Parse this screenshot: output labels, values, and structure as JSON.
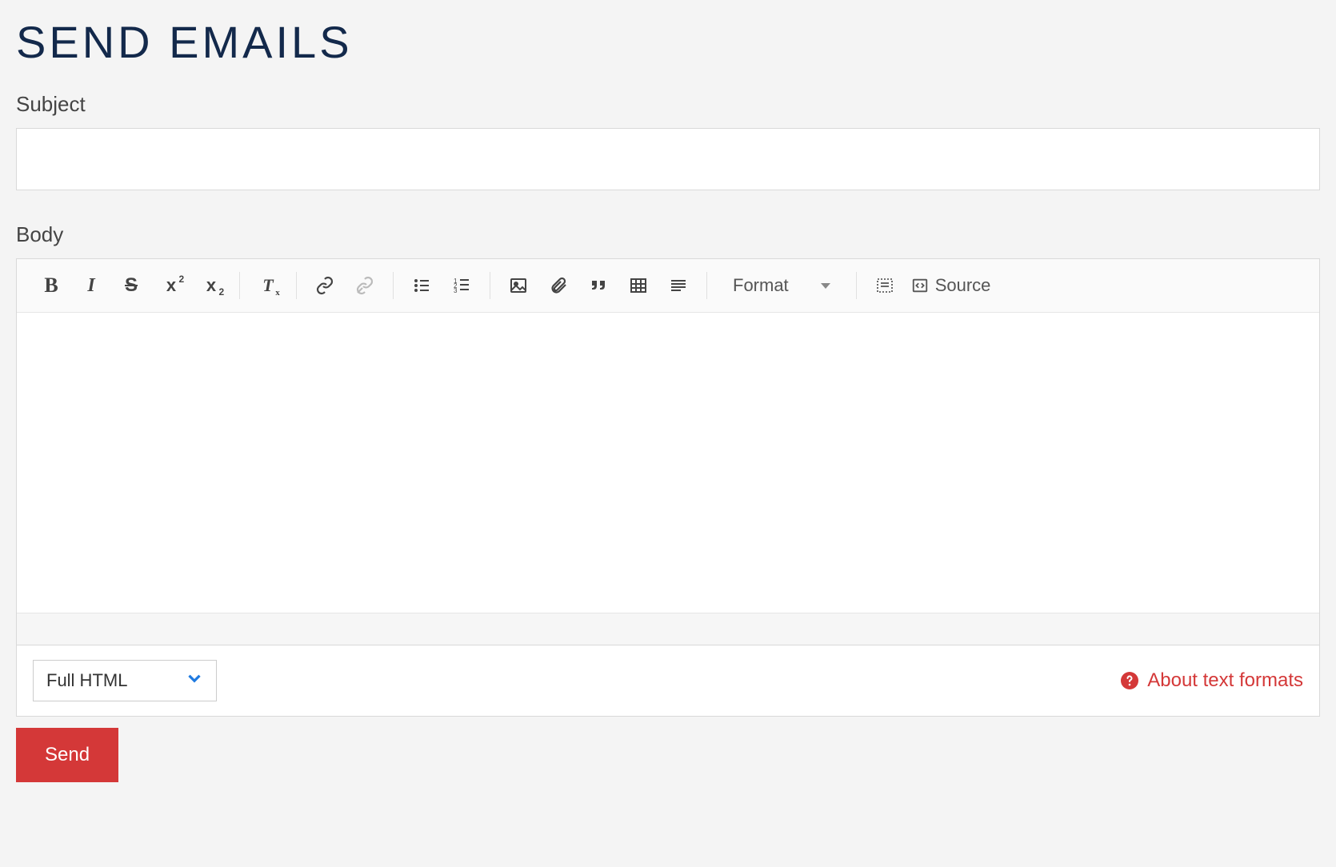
{
  "page": {
    "title": "SEND EMAILS"
  },
  "fields": {
    "subject_label": "Subject",
    "subject_value": "",
    "body_label": "Body",
    "body_value": ""
  },
  "toolbar": {
    "bold": "B",
    "italic": "I",
    "strike": "S",
    "superscript_base": "x",
    "superscript_exp": "2",
    "subscript_base": "x",
    "subscript_exp": "2",
    "remove_format_base": "T",
    "remove_format_sub": "x",
    "format_label": "Format",
    "source_label": "Source"
  },
  "format": {
    "selected": "Full HTML",
    "about_label": "About text formats"
  },
  "actions": {
    "send_label": "Send"
  },
  "icons": {
    "link": "link-icon",
    "unlink": "unlink-icon",
    "bullet_list": "bullet-list-icon",
    "numbered_list": "numbered-list-icon",
    "image": "image-icon",
    "attach": "paperclip-icon",
    "quote": "quote-icon",
    "table": "table-icon",
    "align": "align-icon",
    "show_blocks": "show-blocks-icon",
    "source": "source-icon",
    "chevron": "chevron-down-icon",
    "help": "help-circle-icon"
  }
}
